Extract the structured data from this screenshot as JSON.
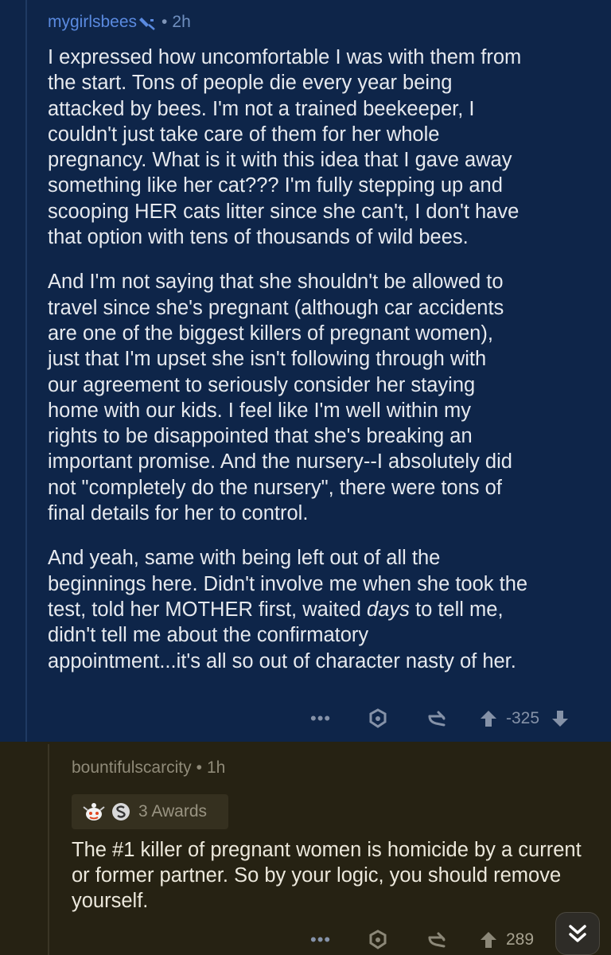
{
  "comment1": {
    "username": "mygirlsbees",
    "time": "2h",
    "paragraphs": [
      "I expressed how uncomfortable I was with them from\nthe start. Tons of people die every year being\nattacked by bees. I'm not a trained beekeeper, I\ncouldn't just take care of them for her whole\npregnancy. What is it with this idea that I gave away\nsomething like her cat??? I'm fully stepping up and\nscooping HER cats litter since she can't, I don't have\nthat option with tens of thousands of wild bees.",
      "And I'm not saying that she shouldn't be allowed to\ntravel since she's pregnant (although car accidents\nare one of the biggest killers of pregnant women),\njust that I'm upset she isn't following through with\nour agreement to seriously consider her staying\nhome with our kids. I feel like I'm well within my\nrights to be disappointed that she's breaking an\nimportant promise. And the nursery--I absolutely did\nnot \"completely do the nursery\", there were tons of\nfinal details for her to control."
    ],
    "p3_before": "And yeah, same with being left out of all the\nbeginnings here. Didn't involve me when she took the\ntest, told her MOTHER first, waited ",
    "p3_em": "days",
    "p3_after": " to tell me,\ndidn't tell me about the confirmatory\nappointment...it's all so out of character nasty of her.",
    "more": "•••",
    "score": "-325"
  },
  "comment2": {
    "username": "bountifulscarcity",
    "time": "1h",
    "awards": "3 Awards",
    "body": "The #1 killer of pregnant women is homicide by a current or former partner.  So by your logic, you should remove yourself.",
    "more": "•••",
    "score": "289"
  },
  "separator": "•",
  "colors": {
    "op_background": "#0e2549",
    "reply_background": "#262213",
    "username_op": "#5a8ae0",
    "upvote": "#8592a8"
  }
}
